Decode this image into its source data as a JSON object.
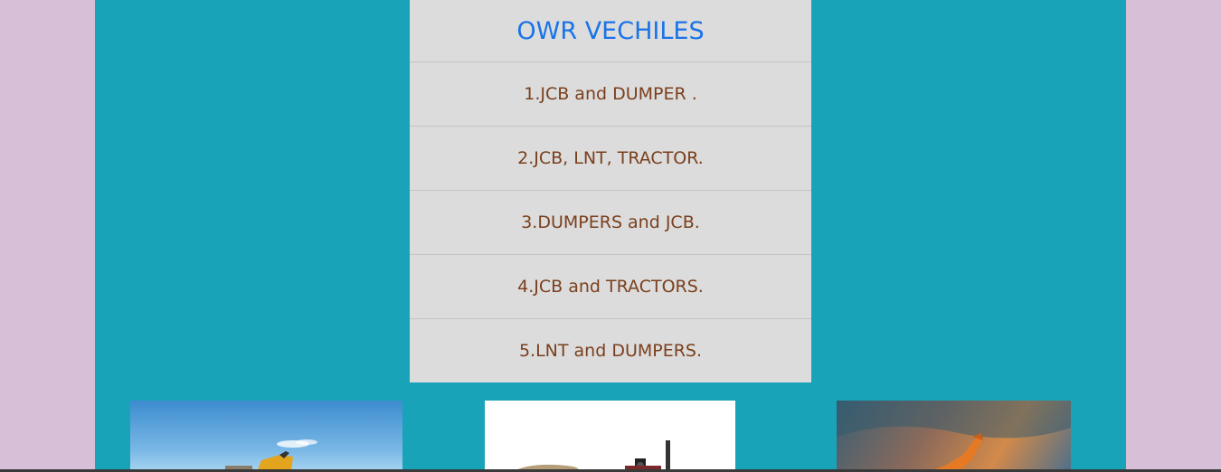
{
  "panel": {
    "title": "OWR VECHILES",
    "items": [
      "1.JCB and DUMPER .",
      "2.JCB, LNT, TRACTOR.",
      "3.DUMPERS and JCB.",
      "4.JCB and TRACTORS.",
      "5.LNT and DUMPERS."
    ]
  },
  "images": [
    {
      "icon": "excavator-sky-photo"
    },
    {
      "icon": "tractor-photo"
    },
    {
      "icon": "excavator-sunset-photo"
    }
  ],
  "colors": {
    "page_bg": "#d8bfd8",
    "container_bg": "#19a3b9",
    "panel_bg": "#dcdcdc",
    "title": "#1a73e8",
    "item_text": "#7a3f1d"
  }
}
